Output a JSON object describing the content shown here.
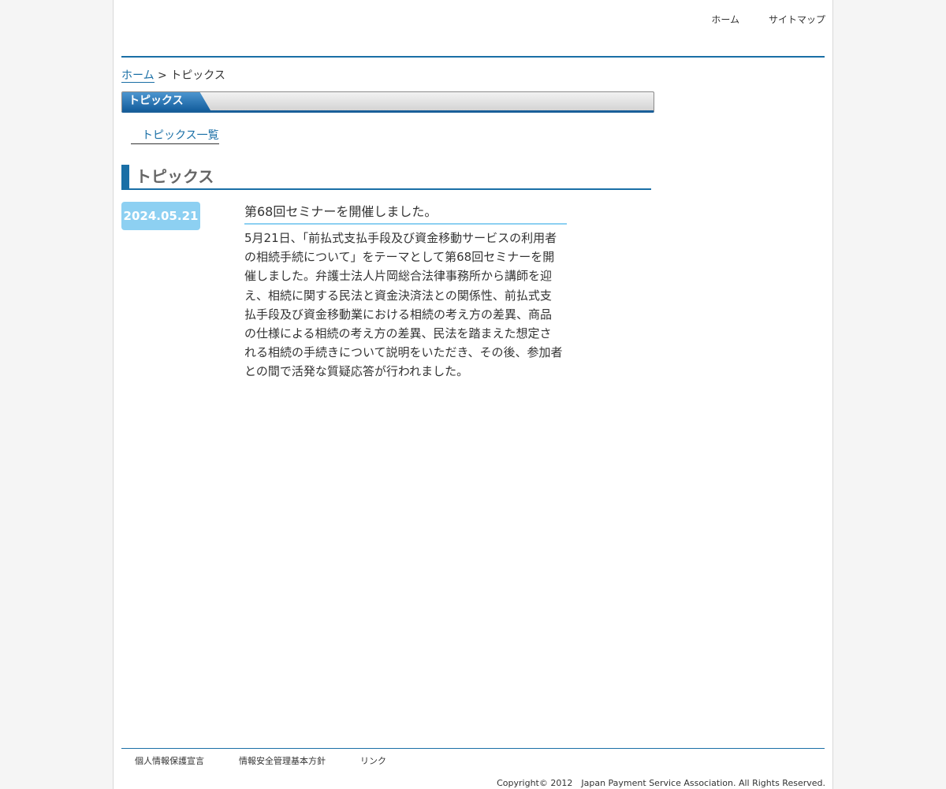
{
  "header": {
    "nav": {
      "home": "ホーム",
      "sitemap": "サイトマップ"
    }
  },
  "breadcrumb": {
    "home": "ホーム",
    "separator": " > ",
    "current": "トピックス"
  },
  "title_bar": {
    "label": "トピックス"
  },
  "topics_list_link": "トピックス一覧",
  "section": {
    "heading": "トピックス"
  },
  "article": {
    "date": "2024.05.21",
    "title": "第68回セミナーを開催しました。",
    "body": "5月21日、「前払式支払手段及び資金移動サービスの利用者の相続手続について」をテーマとして第68回セミナーを開催しました。弁護士法人片岡総合法律事務所から講師を迎え、相続に関する民法と資金決済法との関係性、前払式支払手段及び資金移動業における相続の考え方の差異、商品の仕様による相続の考え方の差異、民法を踏まえた想定される相続の手続きについて説明をいただき、その後、参加者との間で活発な質疑応答が行われました。"
  },
  "footer": {
    "links": {
      "privacy": "個人情報保護宣言",
      "security": "情報安全管理基本方針",
      "links": "リンク"
    },
    "copyright": "Copyright© 2012　Japan Payment Service Association. All Rights Reserved."
  },
  "colors": {
    "accent": "#1a6fa6",
    "date_badge": "#8dd0f2",
    "text": "#333333",
    "heading_text": "#666666"
  }
}
